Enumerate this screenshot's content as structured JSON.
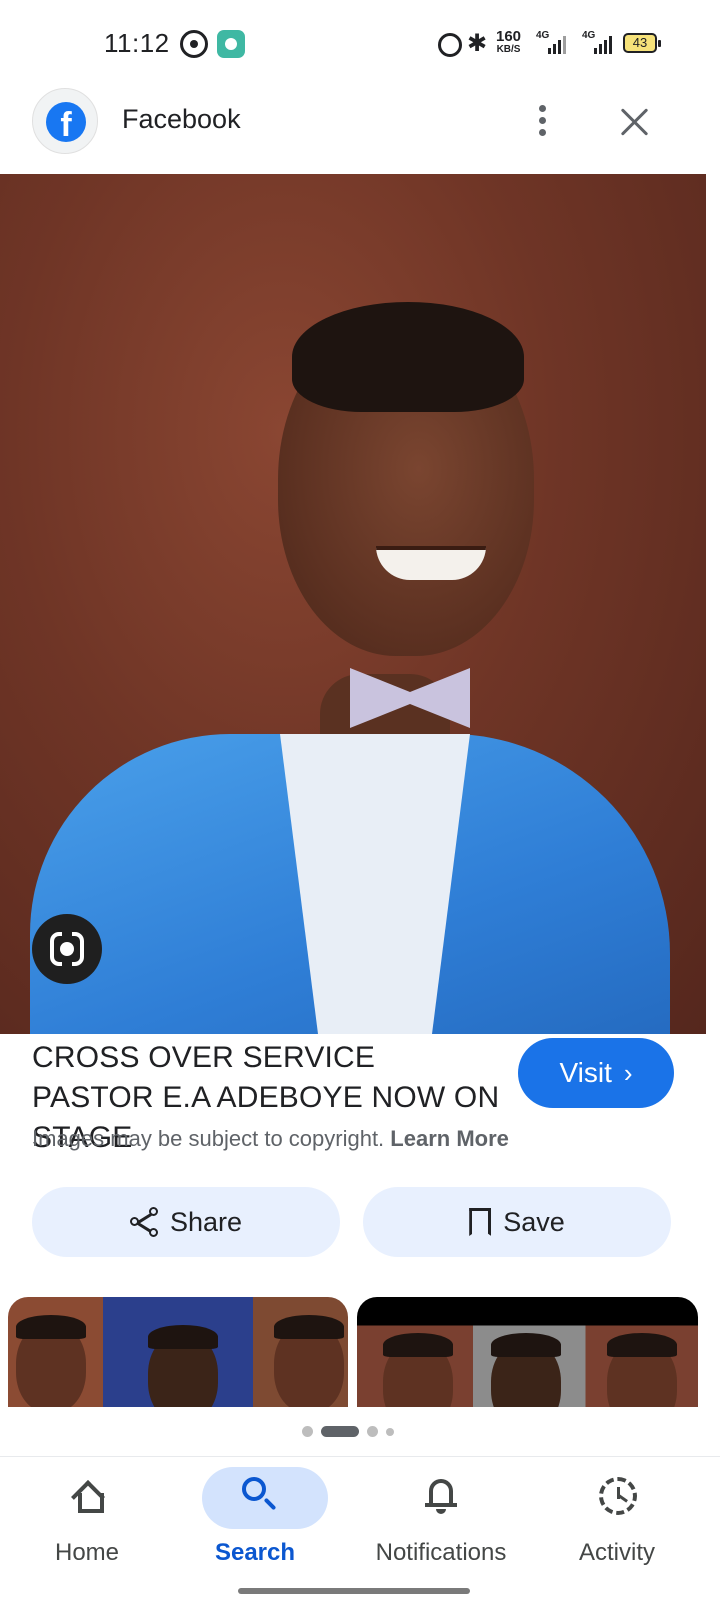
{
  "status_bar": {
    "time": "11:12",
    "net_speed": "160",
    "net_speed_unit": "KB/S",
    "sim1_label": "4G",
    "sim2_label": "4G",
    "battery": "43",
    "icons": [
      "whatsapp-icon",
      "app-notification-icon",
      "alarm-icon",
      "bluetooth-icon",
      "signal-icon",
      "battery-icon"
    ]
  },
  "header": {
    "source_logo": "f",
    "source_name": "Facebook",
    "more_icon": "more-vert-icon",
    "close_icon": "close-icon"
  },
  "image": {
    "lens_icon": "google-lens-icon"
  },
  "result": {
    "title": "CROSS OVER SERVICE PASTOR E.A ADEBOYE NOW ON STAGE",
    "visit_label": "Visit",
    "visit_chevron": "›",
    "copyright_text": "Images may be subject to copyright.",
    "learn_more_label": "Learn More"
  },
  "actions": {
    "share_label": "Share",
    "save_label": "Save"
  },
  "pager": {
    "total": 4,
    "active_index": 1
  },
  "bottom_nav": {
    "items": [
      {
        "label": "Home",
        "icon": "home-icon",
        "active": false
      },
      {
        "label": "Search",
        "icon": "search-icon",
        "active": true
      },
      {
        "label": "Notifications",
        "icon": "bell-icon",
        "active": false
      },
      {
        "label": "Activity",
        "icon": "activity-icon",
        "active": false
      }
    ]
  },
  "colors": {
    "accent": "#1a73e8",
    "nav_active": "#0b57d0",
    "action_bg": "#e8f0fe",
    "facebook": "#1877f2"
  }
}
